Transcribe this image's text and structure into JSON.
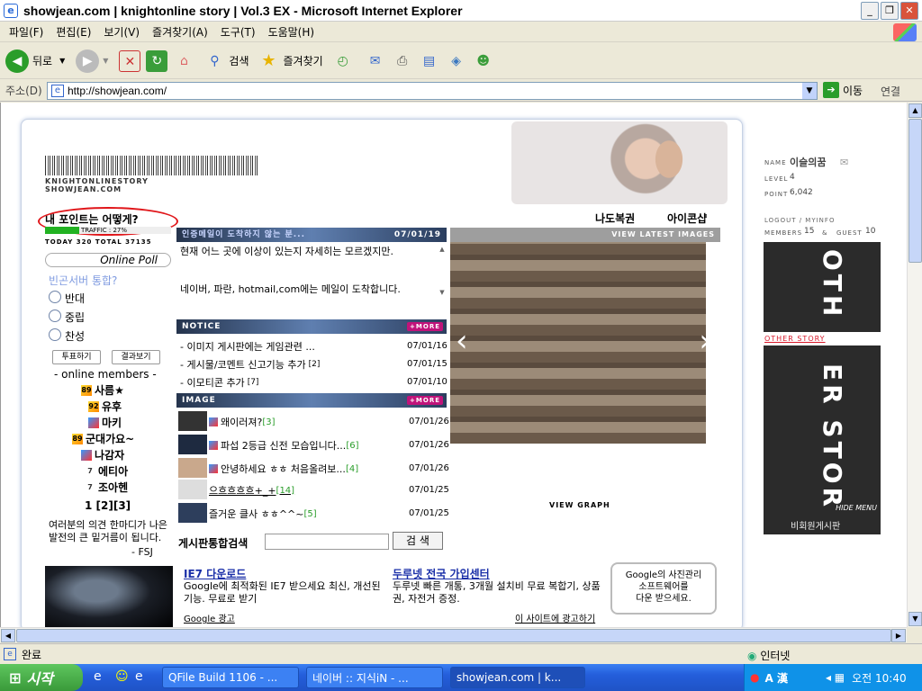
{
  "window": {
    "title": "showjean.com | knightonline story | Vol.3 EX - Microsoft Internet Explorer",
    "min": "_",
    "max": "❐",
    "close": "✕"
  },
  "menubar": [
    "파일(F)",
    "편집(E)",
    "보기(V)",
    "즐겨찾기(A)",
    "도구(T)",
    "도움말(H)"
  ],
  "toolbar": {
    "back": "뒤로",
    "search": "검색",
    "favorites": "즐겨찾기"
  },
  "addressbar": {
    "label": "주소(D)",
    "url": "http://showjean.com/",
    "go": "이동",
    "links": "연결"
  },
  "site": {
    "logo_line1": "KNIGHTONLINESTORY",
    "logo_line2": "SHOWJEAN.COM",
    "point_title": "내 포인트는 어떻게?",
    "traffic": "TRAFFIC : 27%",
    "traffic_pct": 27,
    "today_total": "TODAY  320  TOTAL  37135",
    "top_links": [
      "나도복권",
      "아이콘샵"
    ],
    "poll": {
      "header": "Online Poll",
      "question": "빈곤서버 통합?",
      "options": [
        "반대",
        "중립",
        "찬성"
      ],
      "vote_btn": "투표하기",
      "result_btn": "결과보기"
    },
    "members_title": "- online members -",
    "members": [
      {
        "name": "사름★",
        "lv": "89"
      },
      {
        "name": "유후",
        "lv": "92"
      },
      {
        "name": "마키",
        "lv": "b"
      },
      {
        "name": "군대가요~",
        "lv": "89"
      },
      {
        "name": "나감자",
        "lv": "b"
      },
      {
        "name": "에티아",
        "lv": "7"
      },
      {
        "name": "조아헨",
        "lv": "7"
      }
    ],
    "pages": "1 [2][3]",
    "notice_text": "여러분의 의견 한마디가 나은발전의 큰 밑거름이 됩니다.",
    "notice_sign": "- FSJ",
    "mail": {
      "title": "인증메일이 도착하지 않는 분...",
      "date": "07/01/19",
      "line1": "현재 어느 곳에 이상이 있는지 자세히는 모르겠지만.",
      "line2": "네이버, 파란, hotmail,com에는 메일이 도착합니다."
    },
    "notice": {
      "header": "NOTICE",
      "more": "+MORE",
      "items": [
        {
          "text": "- 이미지 게시판에는 게임관련 ...",
          "count": "",
          "date": "07/01/16"
        },
        {
          "text": "- 게시물/코멘트 신고기능 추가",
          "count": "[2]",
          "date": "07/01/15"
        },
        {
          "text": "- 이모티콘 추가",
          "count": "[7]",
          "date": "07/01/10"
        }
      ]
    },
    "image": {
      "header": "IMAGE",
      "more": "+MORE",
      "items": [
        {
          "text": "왜이러져?",
          "count": "[3]",
          "date": "07/01/26"
        },
        {
          "text": "파섭 2등급 신전 모습입니다...",
          "count": "[6]",
          "date": "07/01/26"
        },
        {
          "text": "안녕하세요 ㅎㅎ 처음올려보...",
          "count": "[4]",
          "date": "07/01/26"
        },
        {
          "text": "으흐흐흐흐+_+",
          "count": "[14]",
          "date": "07/01/25"
        },
        {
          "text": "즐거운 클사 ㅎㅎ^^~",
          "count": "[5]",
          "date": "07/01/25"
        }
      ]
    },
    "search_label": "게시판통합검색",
    "search_btn": "검 색",
    "latest_images": "VIEW LATEST IMAGES",
    "view_graph": "VIEW GRAPH",
    "ads": {
      "ad1_title": "IE7 다운로드",
      "ad1_text": "Google에 최적화된 IE7 받으세요 최신, 개선된 기능. 무료로 받기",
      "ad2_title": "두루넷 전국 가입센터",
      "ad2_text": "두루넷 빠른 개통, 3개월 설치비 무료 복합기, 상품권, 자전거 증정.",
      "google_ads": "Google 광고",
      "site_ad": "이 사이트에 광고하기",
      "google_box_line1": "Google의 사진관리",
      "google_box_line2": "소프트웨어를",
      "google_box_line3": "다운 받으세요."
    },
    "right": {
      "name_k": "NAME",
      "name_v": "이슬의꿈",
      "level_k": "LEVEL",
      "level_v": "4",
      "point_k": "POINT",
      "point_v": "6,042",
      "logout": "LOGOUT  /  MYINFO",
      "members_k": "MEMBERS",
      "members_v": "15",
      "guest_k": "GUEST",
      "guest_v": "10",
      "banner_top": "OTH",
      "banner_bottom": "ER STOR",
      "other_story": "OTHER STORY",
      "hide_menu": "HIDE MENU",
      "member_board": "비회원게시판"
    }
  },
  "status": {
    "text": "완료",
    "zone": "인터넷"
  },
  "taskbar": {
    "start": "시작",
    "tasks": [
      "QFile Build 1106 - ...",
      "네이버 :: 지식iN - ...",
      "showjean.com | k..."
    ],
    "clock": "오전 10:40",
    "ime": "A 漢"
  }
}
